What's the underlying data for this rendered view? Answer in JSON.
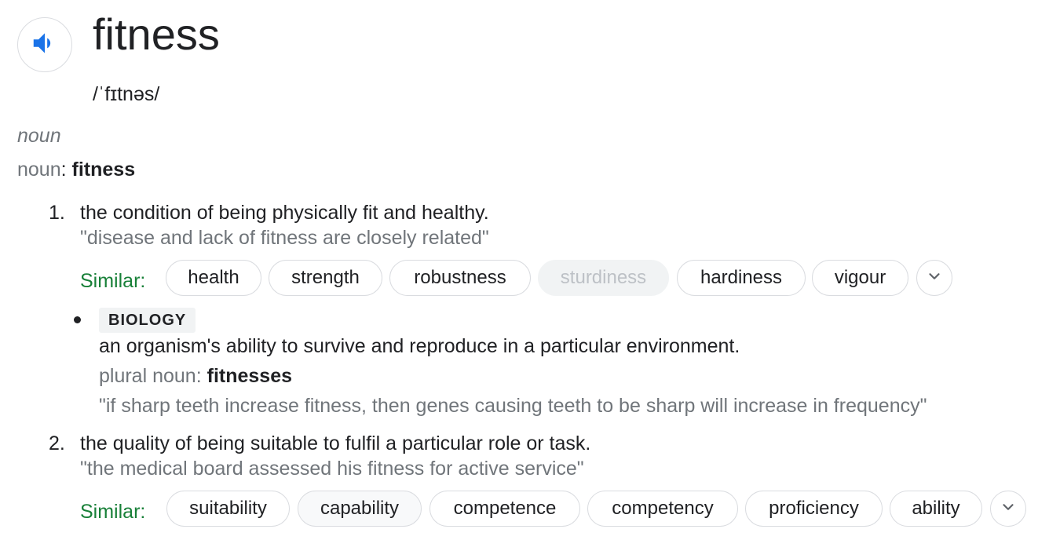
{
  "entry": {
    "word": "fitness",
    "pronunciation": "/ˈfɪtnəs/",
    "audio_icon": "speaker-icon"
  },
  "part_of_speech_italic": "noun",
  "headword_line": {
    "label": "noun",
    "sep": ": ",
    "word": "fitness"
  },
  "senses": [
    {
      "number": "1.",
      "definition": "the condition of being physically fit and healthy.",
      "example": "\"disease and lack of fitness are closely related\"",
      "similar_label": "Similar:",
      "similar": [
        "health",
        "strength",
        "robustness",
        "sturdiness",
        "hardiness",
        "vigour"
      ],
      "subsense": {
        "domain": "BIOLOGY",
        "definition": "an organism's ability to survive and reproduce in a particular environment.",
        "plural_label": "plural noun",
        "plural_sep": ": ",
        "plural_form": "fitnesses",
        "example": "\"if sharp teeth increase fitness, then genes causing teeth to be sharp will increase in frequency\""
      }
    },
    {
      "number": "2.",
      "definition": "the quality of being suitable to fulfil a particular role or task.",
      "example": "\"the medical board assessed his fitness for active service\"",
      "similar_label": "Similar:",
      "similar": [
        "suitability",
        "capability",
        "competence",
        "competency",
        "proficiency",
        "ability"
      ]
    }
  ],
  "colors": {
    "accent": "#1a73e8",
    "similar_label": "#188038",
    "muted": "#70757a",
    "text": "#202124"
  }
}
